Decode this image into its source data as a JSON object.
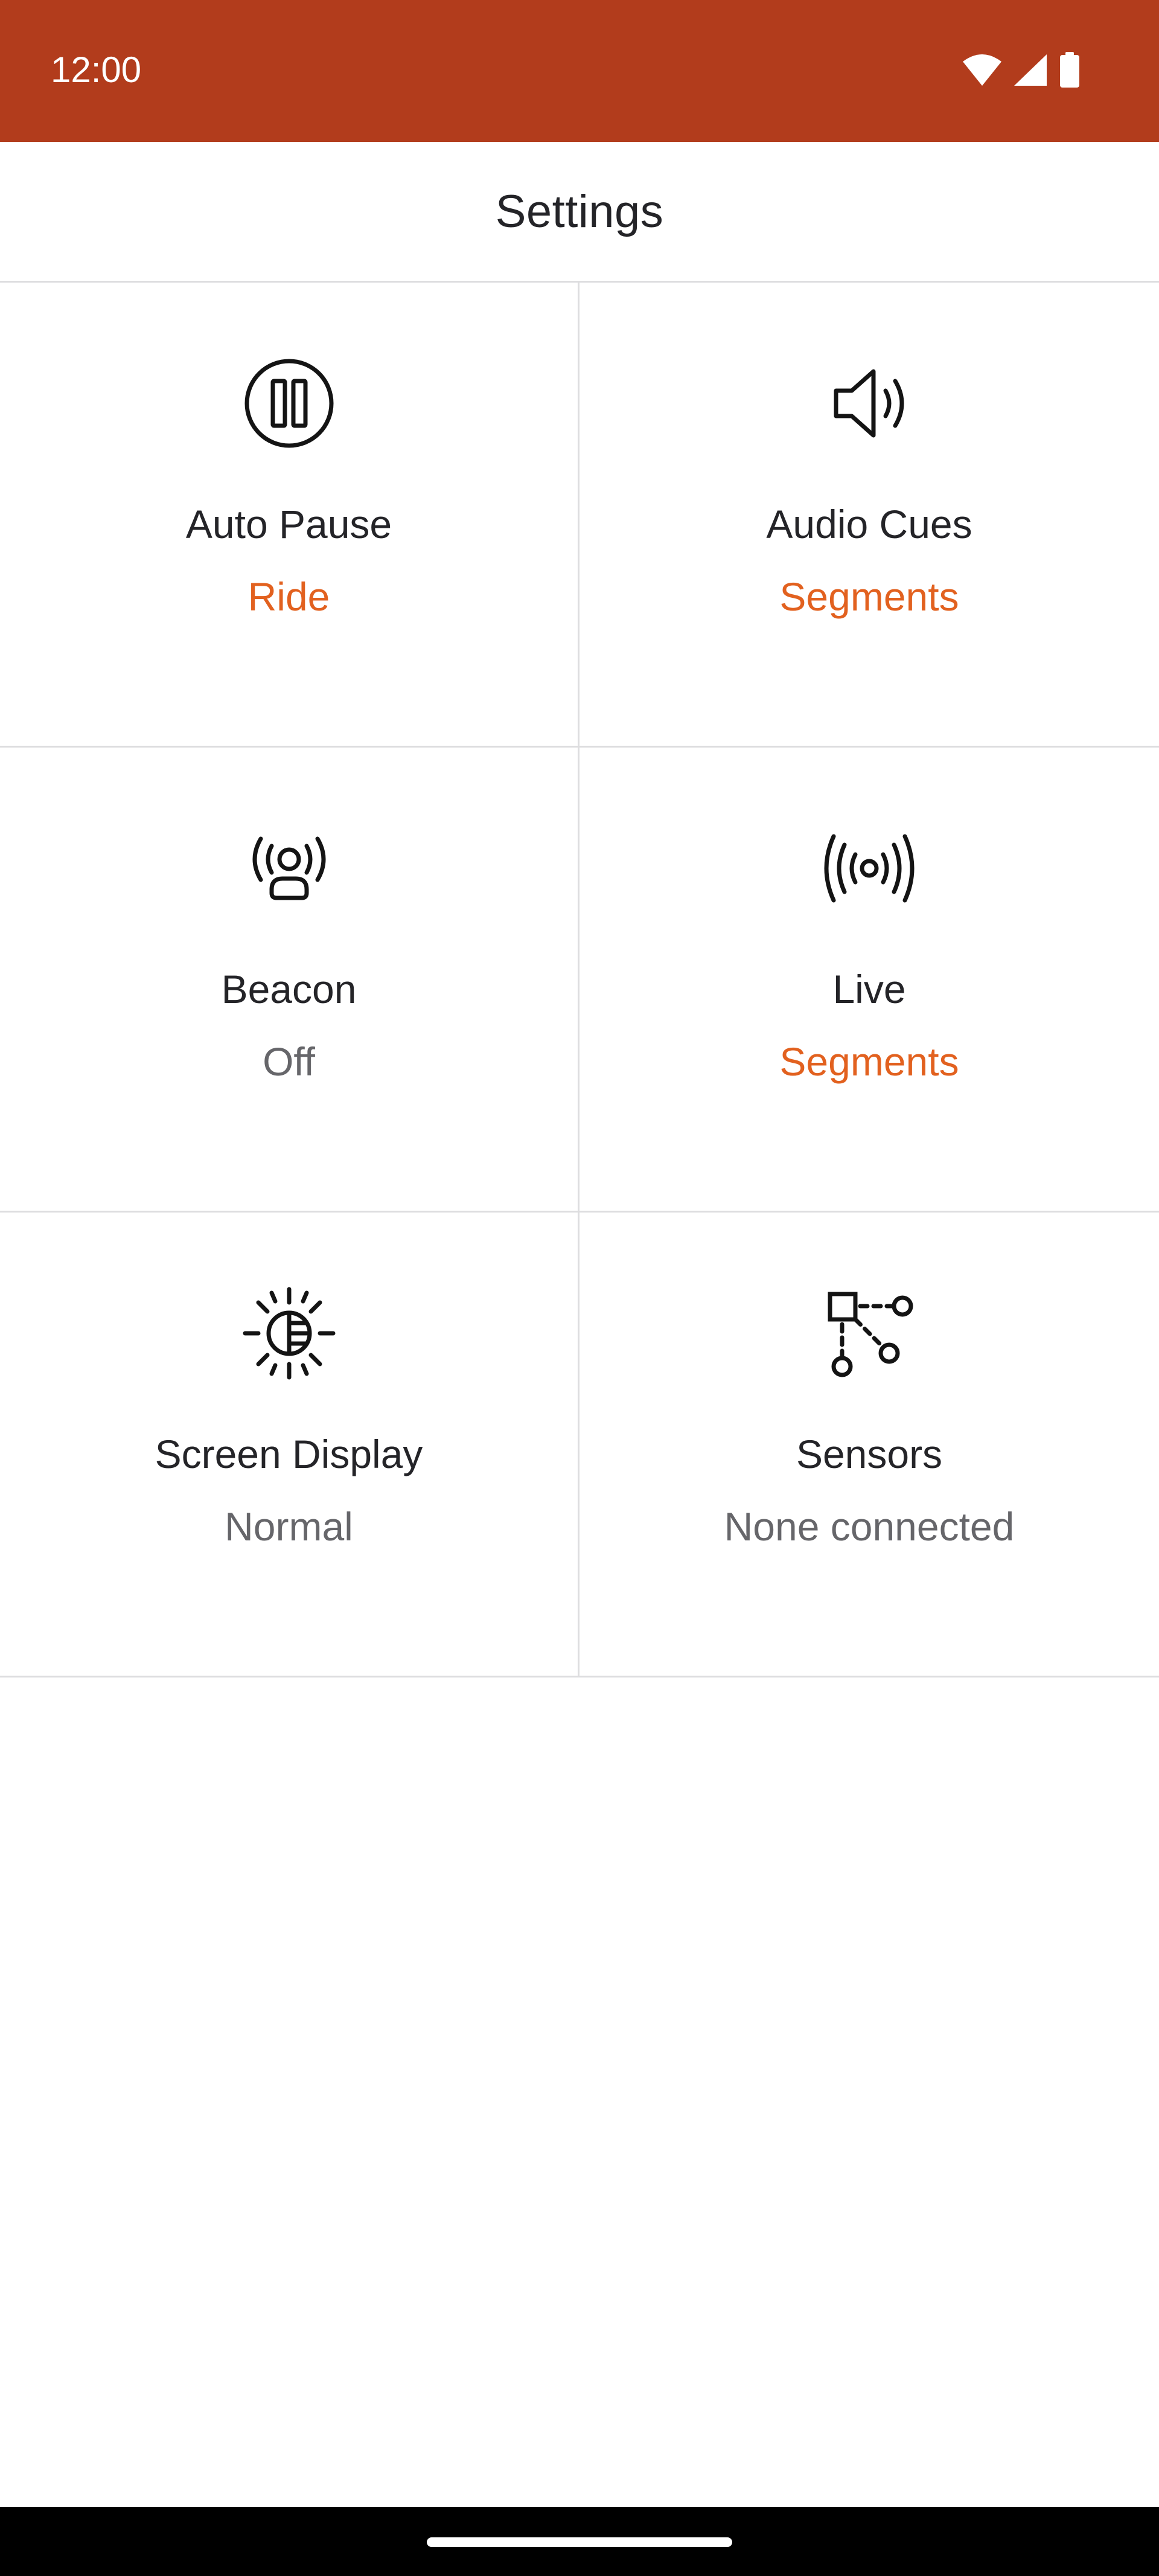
{
  "status_bar": {
    "time": "12:00",
    "icons": [
      "wifi-icon",
      "cellular-signal-icon",
      "battery-icon"
    ],
    "background_color": "#b23c1c"
  },
  "header": {
    "title": "Settings"
  },
  "settings": {
    "auto_pause": {
      "icon": "pause-circle-icon",
      "label": "Auto Pause",
      "value": "Ride",
      "value_color": "#e2611f"
    },
    "audio_cues": {
      "icon": "speaker-icon",
      "label": "Audio Cues",
      "value": "Segments",
      "value_color": "#e2611f"
    },
    "beacon": {
      "icon": "beacon-icon",
      "label": "Beacon",
      "value": "Off",
      "value_color": "#66666a"
    },
    "live": {
      "icon": "live-broadcast-icon",
      "label": "Live",
      "value": "Segments",
      "value_color": "#e2611f"
    },
    "screen_display": {
      "icon": "brightness-icon",
      "label": "Screen Display",
      "value": "Normal",
      "value_color": "#66666a"
    },
    "sensors": {
      "icon": "sensors-icon",
      "label": "Sensors",
      "value": "None connected",
      "value_color": "#66666a"
    }
  },
  "nav_bar": {
    "handle": "home-gesture-handle"
  }
}
